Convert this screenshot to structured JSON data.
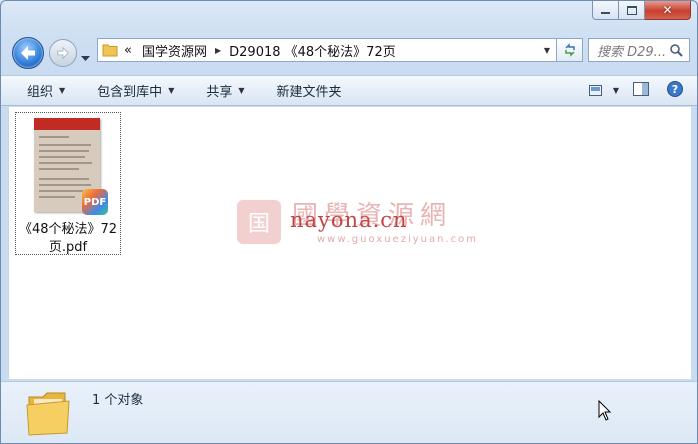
{
  "address": {
    "chevron": "«",
    "segments": [
      "国学资源网",
      "D29018 《48个秘法》72页"
    ]
  },
  "search": {
    "placeholder": "搜索 D29..."
  },
  "toolbar": {
    "organize": "组织",
    "include_in_library": "包含到库中",
    "share": "共享",
    "new_folder": "新建文件夹"
  },
  "files": [
    {
      "name_line1": "《48个秘法》72",
      "name_line2": "页.pdf",
      "badge": "PDF"
    }
  ],
  "watermark": {
    "logo_char": "国",
    "cn": "國學資源網",
    "url": "nayona.cn",
    "small": "www.guoxueziyuan.com"
  },
  "details": {
    "count": "1 个对象"
  },
  "icons": [
    "back-arrow-icon",
    "forward-arrow-icon",
    "folder-icon",
    "refresh-icon",
    "search-icon",
    "view-icon",
    "preview-pane-icon",
    "help-icon",
    "pdf-icon",
    "cursor-icon"
  ],
  "colors": {
    "accent": "#2e7ad6",
    "close": "#c7402e"
  }
}
